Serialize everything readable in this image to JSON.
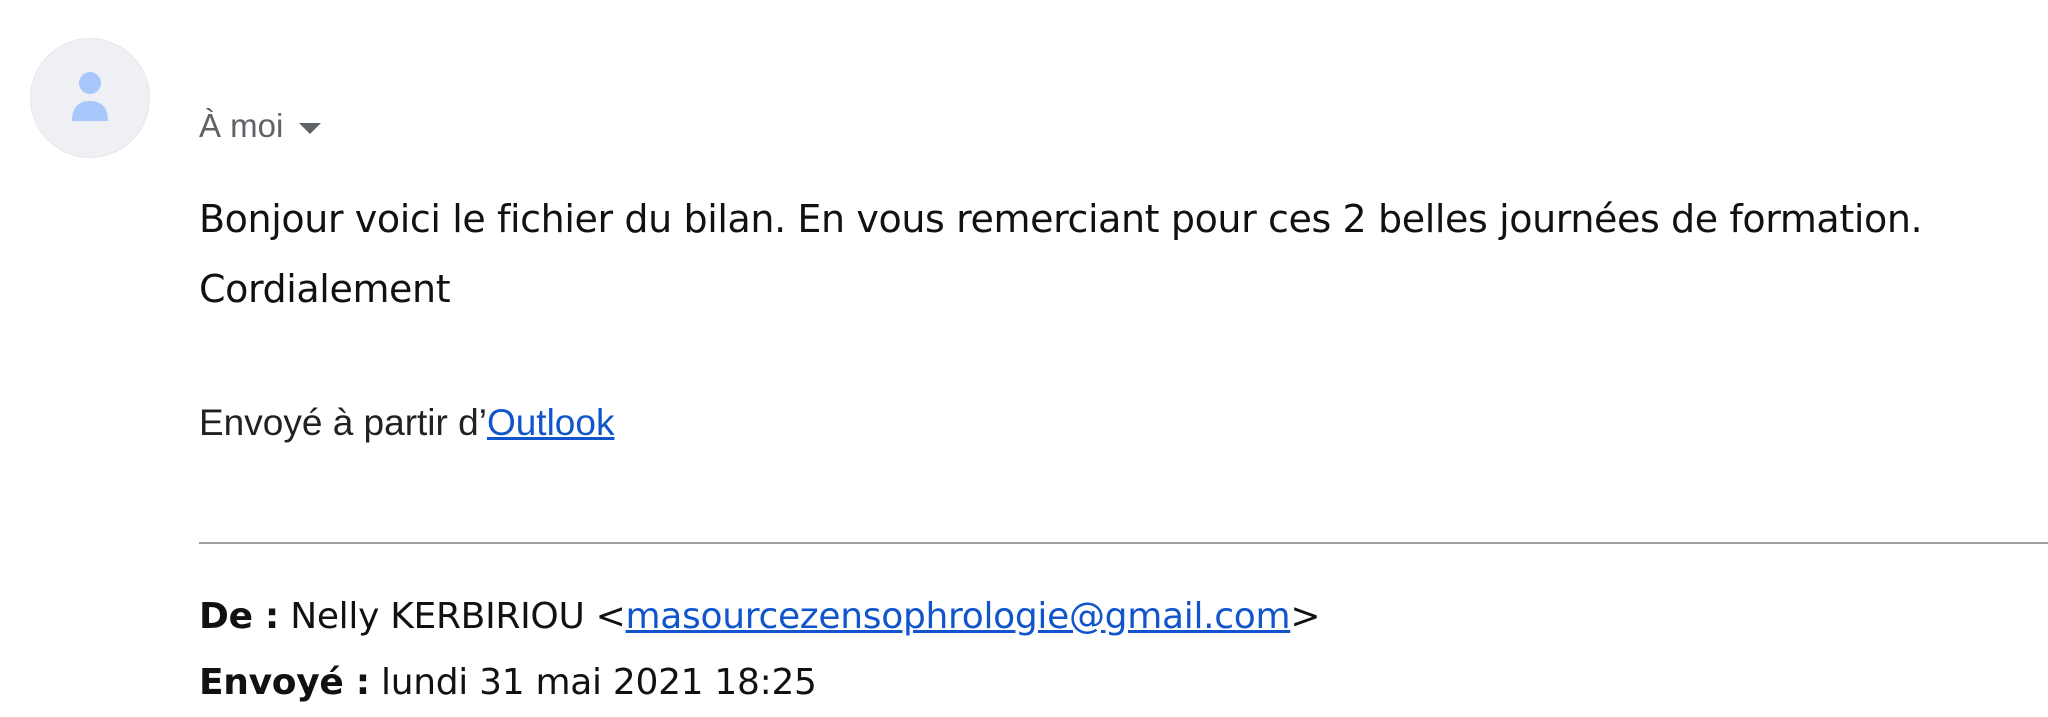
{
  "avatar": {
    "icon": "person-icon",
    "color": "#a8c7fa"
  },
  "recipient": {
    "label": "À moi"
  },
  "message": {
    "line1": "Bonjour voici le fichier du bilan. En vous remerciant pour ces 2 belles journées de formation.",
    "line2": "Cordialement",
    "sent_from_prefix": "Envoyé à partir d’",
    "sent_from_link": "Outlook"
  },
  "forwarded": {
    "from_label": "De :",
    "from_name": "Nelly KERBIRIOU <",
    "from_email": "masourcezensophrologie@gmail.com",
    "from_suffix": ">",
    "sent_label": "Envoyé :",
    "sent_value": "lundi 31 mai 2021 18:25"
  }
}
